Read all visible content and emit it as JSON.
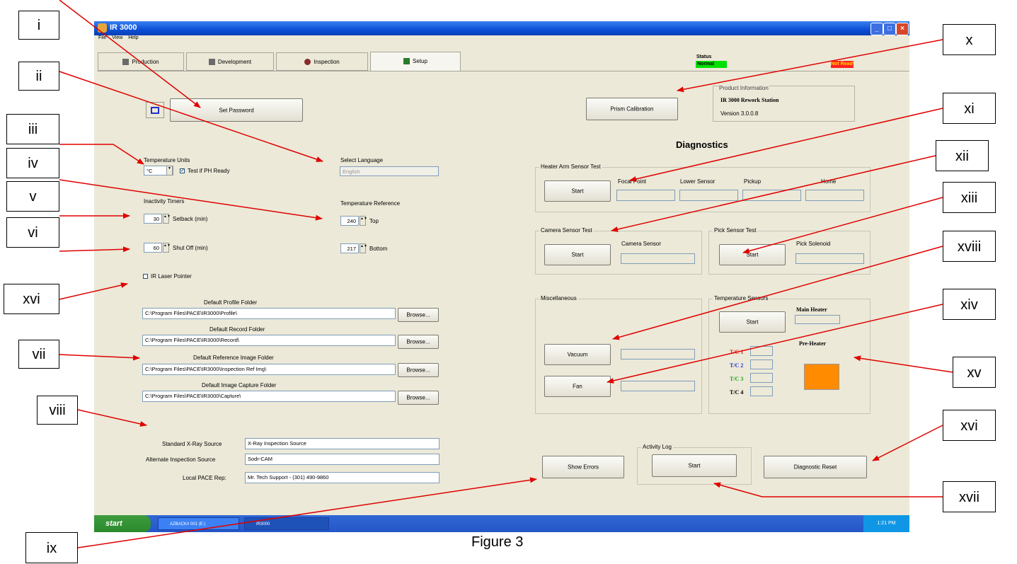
{
  "window": {
    "title": "IR 3000"
  },
  "menu": [
    "File",
    "View",
    "Help"
  ],
  "tabs": [
    "Production",
    "Development",
    "Inspection",
    "Setup"
  ],
  "status": {
    "label": "Status",
    "normal": "Normal",
    "ready": "Not Ready"
  },
  "product": {
    "heading": "Product Information",
    "name": "IR 3000 Rework Station",
    "version": "Version 3.0.0.8"
  },
  "buttons": {
    "set_password": "Set Password",
    "prism_calibration": "Prism Calibration",
    "start": "Start",
    "vacuum": "Vacuum",
    "fan": "Fan",
    "show_errors": "Show Errors",
    "diagnostic_reset": "Diagnostic Reset",
    "browse": "Browse..."
  },
  "diagnostics_title": "Diagnostics",
  "temperature_units": {
    "label": "Temperature Units",
    "value": "°C",
    "checkbox": "Test if PH Ready"
  },
  "select_language": {
    "label": "Select Language",
    "value": "English"
  },
  "inactivity": {
    "label": "Inactivity Timers",
    "setback_value": "30",
    "setback_label": "Setback (min)",
    "shutoff_value": "60",
    "shutoff_label": "Shut Off (min)"
  },
  "temperature_reference": {
    "label": "Temperature Reference",
    "top_value": "240",
    "top_label": "Top",
    "bottom_value": "217",
    "bottom_label": "Bottom"
  },
  "laser": "IR Laser Pointer",
  "folders": [
    {
      "label": "Default Profile Folder",
      "path": "C:\\Program Files\\PACE\\IR3000\\Profile\\"
    },
    {
      "label": "Default Record Folder",
      "path": "C:\\Program Files\\PACE\\IR3000\\Record\\"
    },
    {
      "label": "Default Reference Image Folder",
      "path": "C:\\Program Files\\PACE\\IR3000\\Inspection Ref Img\\"
    },
    {
      "label": "Default Image Capture Folder",
      "path": "C:\\Program Files\\PACE\\IR3000\\Capture\\"
    }
  ],
  "sources": [
    {
      "label": "Standard X-Ray Source",
      "value": "X-Ray Inspection Source"
    },
    {
      "label": "Alternate Inspection Source",
      "value": "Sodr-CAM"
    },
    {
      "label": "Local PACE Rep:",
      "value": "Mr. Tech Support - (301) 490-9860"
    }
  ],
  "heater_arm": {
    "title": "Heater Arm Sensor Test",
    "focal": "Focal Point",
    "lower": "Lower Sensor",
    "pickup": "Pickup",
    "home": "Home"
  },
  "camera_test": {
    "title": "Camera Sensor Test",
    "sensor": "Camera Sensor"
  },
  "pick_test": {
    "title": "Pick Sensor Test",
    "solenoid": "Pick Solenoid"
  },
  "misc": {
    "title": "Miscellaneous"
  },
  "temp_sensors": {
    "title": "Temperature Sensors",
    "main": "Main Heater",
    "pre": "Pre-Heater",
    "tc": [
      "T/C 1",
      "T/C 2",
      "T/C 3",
      "T/C 4"
    ],
    "tc_colors": [
      "#e02020",
      "#2030e0",
      "#20a020",
      "#000000"
    ],
    "preheater_color": "#ff8c00"
  },
  "activity_log": {
    "title": "Activity Log"
  },
  "taskbar": {
    "start": "start",
    "item1": "AZBACK# 001 (E:)",
    "item2": "IR3000",
    "clock": "1:21 PM"
  },
  "caption": "Figure 3",
  "annotations": [
    "i",
    "ii",
    "iii",
    "iv",
    "v",
    "vi",
    "xvi",
    "vii",
    "viii",
    "ix",
    "x",
    "xi",
    "xii",
    "xiii",
    "xviii",
    "xiv",
    "xv",
    "xvi",
    "xvii"
  ]
}
